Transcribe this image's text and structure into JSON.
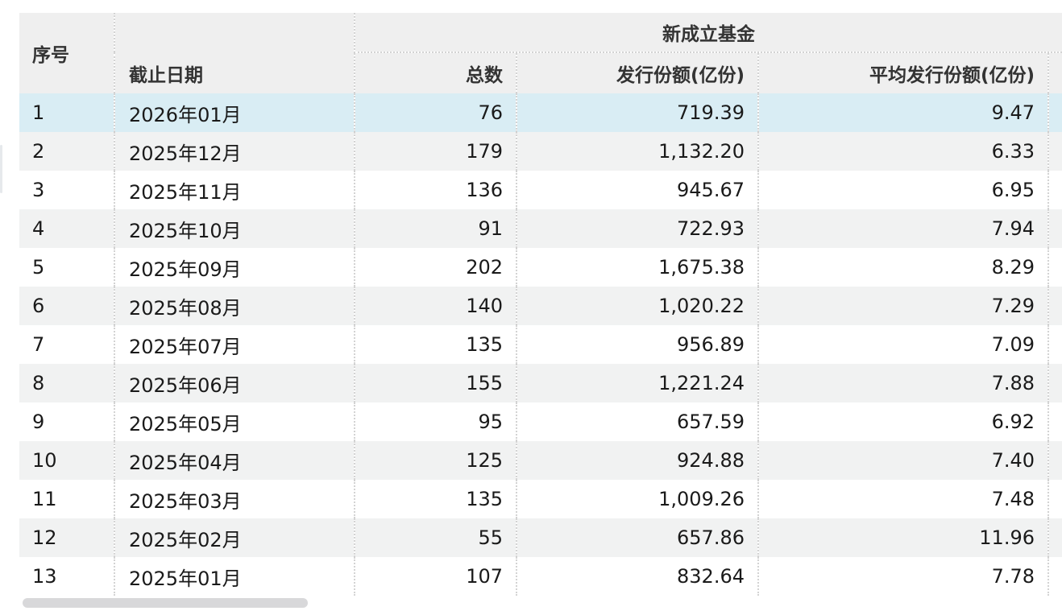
{
  "table": {
    "header": {
      "seq": "序号",
      "group": "新成立基金",
      "date": "截止日期",
      "count": "总数",
      "shares": "发行份额(亿份)",
      "avg": "平均发行份额(亿份)"
    },
    "rows": [
      {
        "seq": "1",
        "date": "2026年01月",
        "count": "76",
        "shares": "719.39",
        "avg": "9.47"
      },
      {
        "seq": "2",
        "date": "2025年12月",
        "count": "179",
        "shares": "1,132.20",
        "avg": "6.33"
      },
      {
        "seq": "3",
        "date": "2025年11月",
        "count": "136",
        "shares": "945.67",
        "avg": "6.95"
      },
      {
        "seq": "4",
        "date": "2025年10月",
        "count": "91",
        "shares": "722.93",
        "avg": "7.94"
      },
      {
        "seq": "5",
        "date": "2025年09月",
        "count": "202",
        "shares": "1,675.38",
        "avg": "8.29"
      },
      {
        "seq": "6",
        "date": "2025年08月",
        "count": "140",
        "shares": "1,020.22",
        "avg": "7.29"
      },
      {
        "seq": "7",
        "date": "2025年07月",
        "count": "135",
        "shares": "956.89",
        "avg": "7.09"
      },
      {
        "seq": "8",
        "date": "2025年06月",
        "count": "155",
        "shares": "1,221.24",
        "avg": "7.88"
      },
      {
        "seq": "9",
        "date": "2025年05月",
        "count": "95",
        "shares": "657.59",
        "avg": "6.92"
      },
      {
        "seq": "10",
        "date": "2025年04月",
        "count": "125",
        "shares": "924.88",
        "avg": "7.40"
      },
      {
        "seq": "11",
        "date": "2025年03月",
        "count": "135",
        "shares": "1,009.26",
        "avg": "7.48"
      },
      {
        "seq": "12",
        "date": "2025年02月",
        "count": "55",
        "shares": "657.86",
        "avg": "11.96"
      },
      {
        "seq": "13",
        "date": "2025年01月",
        "count": "107",
        "shares": "832.64",
        "avg": "7.78"
      }
    ]
  },
  "colors": {
    "header_bg": "#efefef",
    "stripe_bg": "#f1f2f2",
    "selected_row_bg": "#d9edf4",
    "text": "#1a1a1a"
  }
}
